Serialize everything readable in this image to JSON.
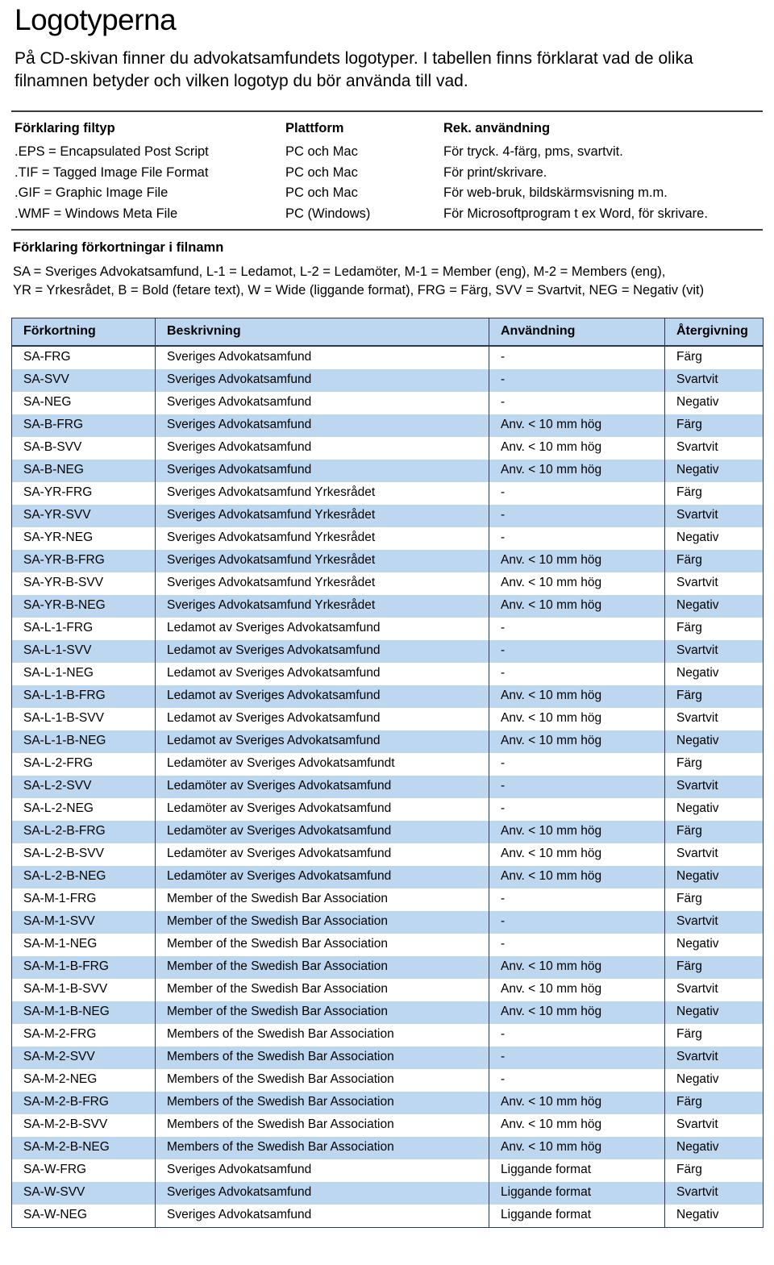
{
  "document": {
    "title": "Logotyperna",
    "intro": "På CD-skivan finner du advokatsamfundets logotyper. I tabellen finns förklarat vad de olika filnamnen betyder och vilken logotyp du bör använda till vad.",
    "accent_header_color": "#bdd7f0",
    "rule_color": "#3a3a3a",
    "border_color": "#2b3a52"
  },
  "filetype_section": {
    "headers": {
      "c1": "Förklaring filtyp",
      "c2": "Plattform",
      "c3": "Rek. användning"
    },
    "rows": [
      {
        "c1": ".EPS = Encapsulated Post Script",
        "c2": "PC och Mac",
        "c3": "För tryck. 4-färg, pms, svartvit."
      },
      {
        "c1": ".TIF = Tagged Image File Format",
        "c2": "PC och Mac",
        "c3": "För print/skrivare."
      },
      {
        "c1": ".GIF = Graphic Image File",
        "c2": "PC och Mac",
        "c3": "För web-bruk, bildskärmsvisning m.m."
      },
      {
        "c1": ".WMF = Windows Meta File",
        "c2": "PC (Windows)",
        "c3": "För Microsoftprogram t ex Word, för skrivare."
      }
    ]
  },
  "abbreviation_section": {
    "heading": "Förklaring förkortningar i filnamn",
    "line1": "SA = Sveriges Advokatsamfund, L-1 = Ledamot, L-2 = Ledamöter, M-1 = Member (eng), M-2 = Members (eng),",
    "line2": "YR = Yrkesrådet, B = Bold (fetare text), W = Wide (liggande format), FRG = Färg, SVV = Svartvit, NEG = Negativ (vit)"
  },
  "main_table": {
    "columns": [
      "Förkortning",
      "Beskrivning",
      "Användning",
      "Återgivning"
    ],
    "rows": [
      [
        "SA-FRG",
        "Sveriges Advokatsamfund",
        "-",
        "Färg"
      ],
      [
        "SA-SVV",
        "Sveriges Advokatsamfund",
        "-",
        "Svartvit"
      ],
      [
        "SA-NEG",
        "Sveriges Advokatsamfund",
        "-",
        "Negativ"
      ],
      [
        "SA-B-FRG",
        "Sveriges Advokatsamfund",
        "Anv. < 10 mm hög",
        "Färg"
      ],
      [
        "SA-B-SVV",
        "Sveriges Advokatsamfund",
        "Anv. < 10 mm hög",
        "Svartvit"
      ],
      [
        "SA-B-NEG",
        "Sveriges Advokatsamfund",
        "Anv. < 10 mm hög",
        "Negativ"
      ],
      [
        "SA-YR-FRG",
        "Sveriges Advokatsamfund Yrkesrådet",
        "-",
        "Färg"
      ],
      [
        "SA-YR-SVV",
        "Sveriges Advokatsamfund Yrkesrådet",
        "-",
        "Svartvit"
      ],
      [
        "SA-YR-NEG",
        "Sveriges Advokatsamfund Yrkesrådet",
        "-",
        "Negativ"
      ],
      [
        "SA-YR-B-FRG",
        "Sveriges Advokatsamfund Yrkesrådet",
        "Anv. < 10 mm hög",
        "Färg"
      ],
      [
        "SA-YR-B-SVV",
        "Sveriges Advokatsamfund Yrkesrådet",
        "Anv. < 10 mm hög",
        "Svartvit"
      ],
      [
        "SA-YR-B-NEG",
        "Sveriges Advokatsamfund Yrkesrådet",
        "Anv. < 10 mm hög",
        "Negativ"
      ],
      [
        "SA-L-1-FRG",
        "Ledamot av Sveriges Advokatsamfund",
        "-",
        "Färg"
      ],
      [
        "SA-L-1-SVV",
        "Ledamot av Sveriges Advokatsamfund",
        "-",
        "Svartvit"
      ],
      [
        "SA-L-1-NEG",
        "Ledamot av Sveriges Advokatsamfund",
        "-",
        "Negativ"
      ],
      [
        "SA-L-1-B-FRG",
        "Ledamot av Sveriges Advokatsamfund",
        "Anv. < 10 mm hög",
        "Färg"
      ],
      [
        "SA-L-1-B-SVV",
        "Ledamot av Sveriges Advokatsamfund",
        "Anv. < 10 mm hög",
        "Svartvit"
      ],
      [
        "SA-L-1-B-NEG",
        "Ledamot av Sveriges Advokatsamfund",
        "Anv. < 10 mm hög",
        "Negativ"
      ],
      [
        "SA-L-2-FRG",
        "Ledamöter av Sveriges Advokatsamfundt",
        "-",
        "Färg"
      ],
      [
        "SA-L-2-SVV",
        "Ledamöter av Sveriges Advokatsamfund",
        "-",
        "Svartvit"
      ],
      [
        "SA-L-2-NEG",
        "Ledamöter av Sveriges Advokatsamfund",
        "-",
        "Negativ"
      ],
      [
        "SA-L-2-B-FRG",
        "Ledamöter av Sveriges Advokatsamfund",
        "Anv. < 10 mm hög",
        "Färg"
      ],
      [
        "SA-L-2-B-SVV",
        "Ledamöter av Sveriges Advokatsamfund",
        "Anv. < 10 mm hög",
        "Svartvit"
      ],
      [
        "SA-L-2-B-NEG",
        "Ledamöter av Sveriges Advokatsamfund",
        "Anv. < 10 mm hög",
        "Negativ"
      ],
      [
        "SA-M-1-FRG",
        "Member of the Swedish Bar Association",
        "-",
        "Färg"
      ],
      [
        "SA-M-1-SVV",
        "Member of the Swedish Bar Association",
        "-",
        "Svartvit"
      ],
      [
        "SA-M-1-NEG",
        "Member of the Swedish Bar Association",
        "-",
        "Negativ"
      ],
      [
        "SA-M-1-B-FRG",
        "Member of the Swedish Bar Association",
        "Anv. < 10 mm hög",
        "Färg"
      ],
      [
        "SA-M-1-B-SVV",
        "Member of the Swedish Bar Association",
        "Anv. < 10 mm hög",
        "Svartvit"
      ],
      [
        "SA-M-1-B-NEG",
        "Member of the Swedish Bar Association",
        "Anv. < 10 mm hög",
        "Negativ"
      ],
      [
        "SA-M-2-FRG",
        "Members of the Swedish Bar Association",
        "-",
        "Färg"
      ],
      [
        "SA-M-2-SVV",
        "Members of the Swedish Bar Association",
        "-",
        "Svartvit"
      ],
      [
        "SA-M-2-NEG",
        "Members of the Swedish Bar Association",
        "-",
        "Negativ"
      ],
      [
        "SA-M-2-B-FRG",
        "Members of the Swedish Bar Association",
        "Anv. < 10 mm hög",
        "Färg"
      ],
      [
        "SA-M-2-B-SVV",
        "Members of the Swedish Bar Association",
        "Anv. < 10 mm hög",
        "Svartvit"
      ],
      [
        "SA-M-2-B-NEG",
        "Members of the Swedish Bar Association",
        "Anv. < 10 mm hög",
        "Negativ"
      ],
      [
        "SA-W-FRG",
        "Sveriges Advokatsamfund",
        "Liggande format",
        "Färg"
      ],
      [
        "SA-W-SVV",
        "Sveriges Advokatsamfund",
        "Liggande format",
        "Svartvit"
      ],
      [
        "SA-W-NEG",
        "Sveriges Advokatsamfund",
        "Liggande format",
        "Negativ"
      ]
    ]
  }
}
